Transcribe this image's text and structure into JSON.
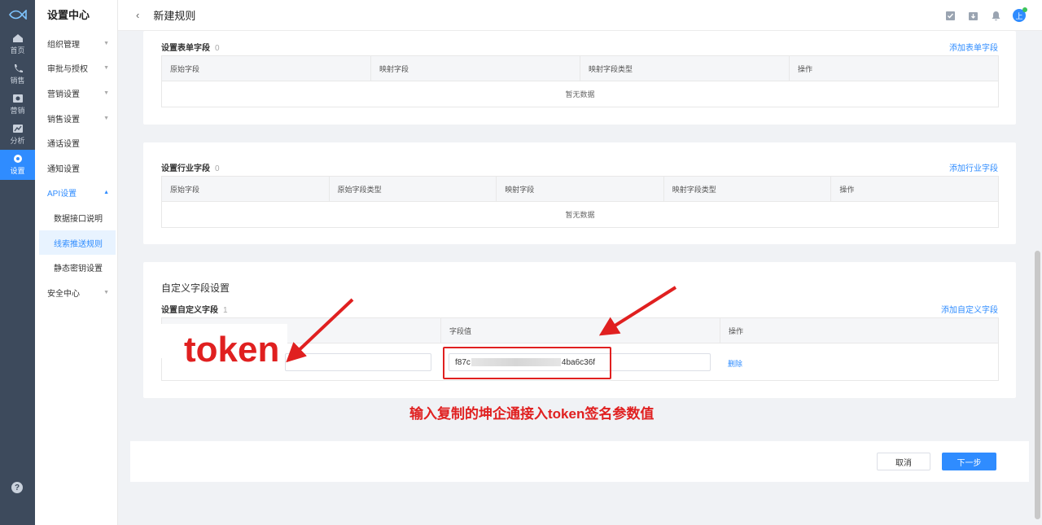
{
  "rail": {
    "items": [
      {
        "label": "首页",
        "icon": "home-icon"
      },
      {
        "label": "销售",
        "icon": "phone-icon"
      },
      {
        "label": "营销",
        "icon": "marketing-icon"
      },
      {
        "label": "分析",
        "icon": "chart-icon"
      },
      {
        "label": "设置",
        "icon": "gear-icon",
        "active": true
      }
    ],
    "help": "?"
  },
  "menu": {
    "title": "设置中心",
    "items": [
      {
        "label": "组织管理"
      },
      {
        "label": "审批与授权"
      },
      {
        "label": "营销设置"
      },
      {
        "label": "销售设置"
      },
      {
        "label": "通话设置"
      },
      {
        "label": "通知设置"
      },
      {
        "label": "API设置"
      }
    ],
    "sub": [
      {
        "label": "数据接口说明"
      },
      {
        "label": "线索推送规则"
      },
      {
        "label": "静态密钥设置"
      }
    ],
    "security": "安全中心"
  },
  "topbar": {
    "back": "‹",
    "title": "新建规则",
    "avatar": "上"
  },
  "form_fields": {
    "title": "设置表单字段",
    "count": "0",
    "add": "添加表单字段",
    "columns": [
      "原始字段",
      "映射字段",
      "映射字段类型",
      "操作"
    ],
    "empty": "暂无数据"
  },
  "industry_fields": {
    "title": "设置行业字段",
    "count": "0",
    "add": "添加行业字段",
    "columns": [
      "原始字段",
      "原始字段类型",
      "映射字段",
      "映射字段类型",
      "操作"
    ],
    "empty": "暂无数据"
  },
  "custom": {
    "section_title": "自定义字段设置",
    "title": "设置自定义字段",
    "count": "1",
    "add": "添加自定义字段",
    "columns": [
      "",
      "字段值",
      "操作"
    ],
    "row": {
      "name": "",
      "value_start": "f87c",
      "value_end": "4ba6c36f",
      "delete": "删除"
    }
  },
  "footer": {
    "cancel": "取消",
    "next": "下一步"
  },
  "annotation": {
    "token": "token",
    "hint": "输入复制的坤企通接入token签名参数值",
    "color": "#e02020"
  }
}
